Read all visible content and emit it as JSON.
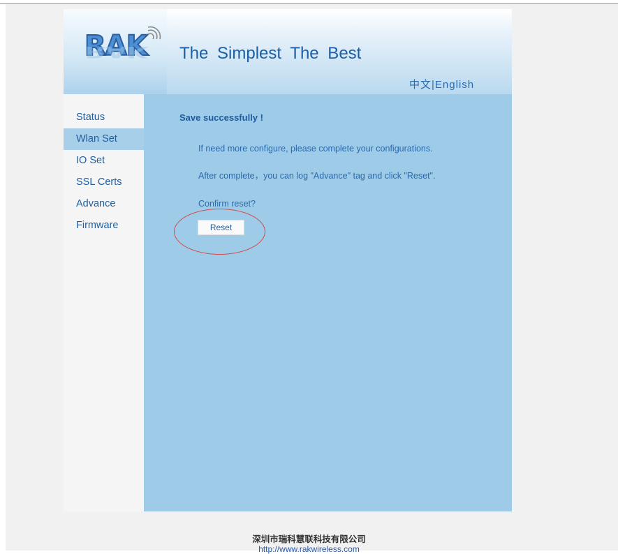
{
  "header": {
    "logo_text": "RAK",
    "slogan": "The  Simplest  The  Best",
    "lang_chinese": "中文",
    "lang_separator": "|",
    "lang_english": "English"
  },
  "sidebar": {
    "items": [
      {
        "label": "Status"
      },
      {
        "label": "Wlan Set"
      },
      {
        "label": "IO Set"
      },
      {
        "label": "SSL Certs"
      },
      {
        "label": "Advance"
      },
      {
        "label": "Firmware"
      }
    ],
    "active": "Wlan Set"
  },
  "main": {
    "save_message": "Save successfully !",
    "line1": "If need more configure, please complete your configurations.",
    "line2": "After complete，you can log \"Advance\" tag and click \"Reset\".",
    "confirm_text": "Confirm reset?",
    "reset_button": "Reset"
  },
  "footer": {
    "company": "深圳市瑞科慧联科技有限公司",
    "url": "http://www.rakwireless.com"
  },
  "colors": {
    "main_bg": "#9dcbe8",
    "active_item_bg": "#a8cfe9",
    "text_blue": "#215e9e",
    "annotation_red": "#d24c4c"
  }
}
